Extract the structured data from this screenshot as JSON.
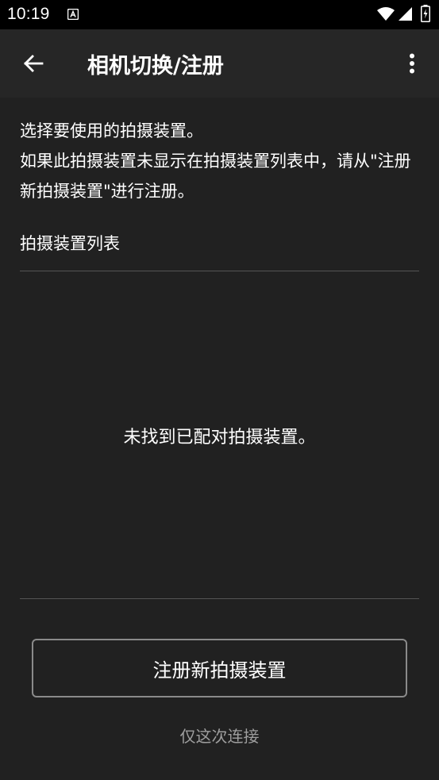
{
  "status_bar": {
    "time": "10:19",
    "notification_icon": "a-badge-icon",
    "wifi_icon": "wifi-icon",
    "signal_icon": "signal-icon",
    "battery_icon": "battery-charging-icon"
  },
  "app_bar": {
    "back_icon": "arrow-left-icon",
    "title": "相机切换/注册",
    "overflow_icon": "more-vert-icon"
  },
  "description": {
    "line1": "选择要使用的拍摄装置。",
    "line2": "如果此拍摄装置未显示在拍摄装置列表中，请从\"注册新拍摄装置\"进行注册。"
  },
  "device_list": {
    "header": "拍摄装置列表",
    "empty_message": "未找到已配对拍摄装置。"
  },
  "actions": {
    "register_label": "注册新拍摄装置",
    "connect_once_label": "仅这次连接"
  },
  "colors": {
    "background": "#212121",
    "app_bar": "#262626",
    "status_bar": "#000000",
    "divider": "#555555",
    "secondary_text": "#9e9e9e"
  }
}
